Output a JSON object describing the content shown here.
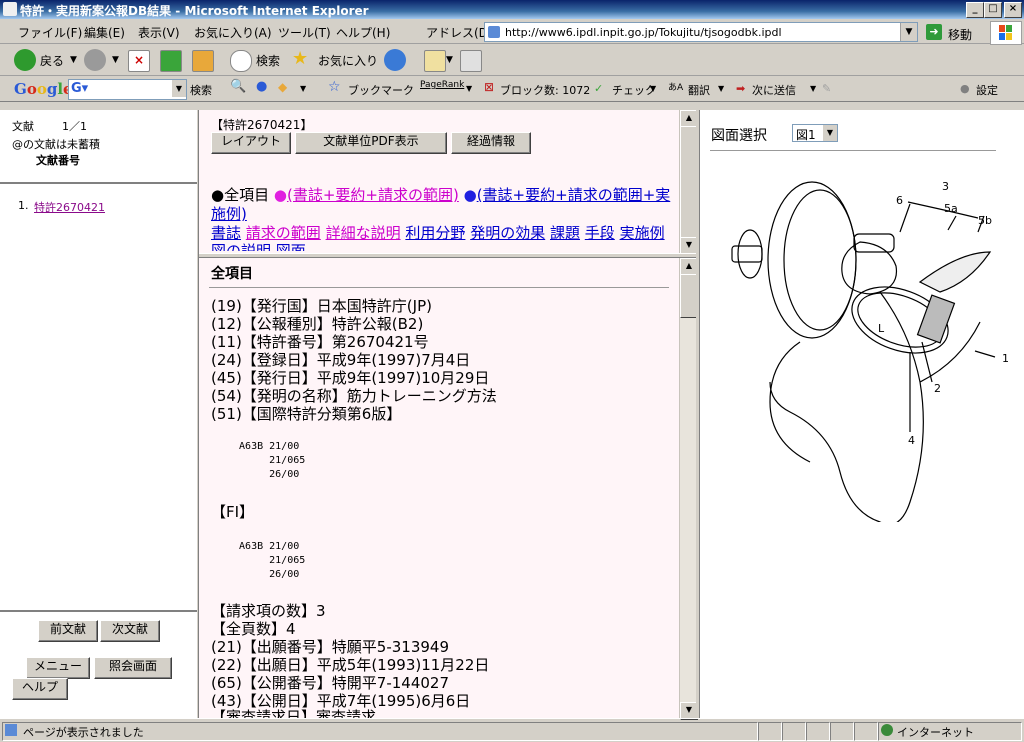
{
  "window": {
    "title": "特許・実用新案公報DB結果 - Microsoft Internet Explorer"
  },
  "menubar": {
    "items": [
      "ファイル(F)",
      "編集(E)",
      "表示(V)",
      "お気に入り(A)",
      "ツール(T)",
      "ヘルプ(H)"
    ],
    "address_label": "アドレス(D)",
    "address_url": "http://www6.ipdl.inpit.go.jp/Tokujitu/tjsogodbk.ipdl",
    "go_label": "移動"
  },
  "toolbar": {
    "back": "戻る",
    "search": "検索",
    "favorites": "お気に入り"
  },
  "googlebar": {
    "logo": "Google",
    "search_label": "検索",
    "bookmarks": "ブックマーク",
    "pagerank": "PageRank",
    "blocked": "ブロック数: 1072",
    "check": "チェック",
    "translate": "翻訳",
    "send": "次に送信",
    "settings": "設定"
  },
  "left": {
    "doc_label": "文献",
    "doc_count": "1／1",
    "unsaved_note": "@の文献は未蓄積",
    "doc_number_header": "文献番号",
    "list": [
      {
        "num": "1.",
        "link": "特許2670421"
      }
    ],
    "buttons": {
      "prev": "前文献",
      "next": "次文献",
      "menu": "メニュー",
      "inquiry": "照会画面",
      "help": "ヘルプ"
    }
  },
  "midtop": {
    "patent_header": "【特許2670421】",
    "buttons": {
      "layout": "レイアウト",
      "pdf": "文献単位PDF表示",
      "history": "経過情報"
    },
    "all_items_bullet": "●",
    "all_items": "全項目",
    "m1_bullet": "●",
    "m1": "(書誌+要約+請求の範囲)",
    "m2_bullet": "●",
    "m2": "(書誌+要約+請求の範囲+実施例)",
    "links": [
      "書誌",
      "請求の範囲",
      "詳細な説明",
      "利用分野",
      "発明の効果",
      "課題",
      "手段",
      "実施例",
      "図の説明",
      "図面"
    ]
  },
  "midbot": {
    "heading": "全項目",
    "lines1": [
      "(19)【発行国】日本国特許庁(JP)",
      "(12)【公報種別】特許公報(B2)",
      "(11)【特許番号】第2670421号",
      "(24)【登録日】平成9年(1997)7月4日",
      "(45)【発行日】平成9年(1997)10月29日",
      "(54)【発明の名称】筋力トレーニング方法",
      "(51)【国際特許分類第6版】"
    ],
    "ipc_block": "  A63B 21/00\n       21/065\n       26/00",
    "fi_label": "【FI】",
    "fi_block": "  A63B 21/00\n       21/065\n       26/00",
    "lines2": [
      "【請求項の数】3",
      "【全頁数】4",
      "(21)【出願番号】特願平5-313949",
      "(22)【出願日】平成5年(1993)11月22日",
      "(65)【公開番号】特開平7-144027",
      "(43)【公開日】平成7年(1995)6月6日",
      "【審査請求日】審査請求"
    ]
  },
  "right": {
    "figure_select_label": "図面選択",
    "figure_option": "図1",
    "figure_labels": [
      "3",
      "6",
      "5a",
      "5b",
      "L",
      "1",
      "2",
      "4"
    ]
  },
  "status": {
    "message": "ページが表示されました",
    "zone": "インターネット"
  }
}
